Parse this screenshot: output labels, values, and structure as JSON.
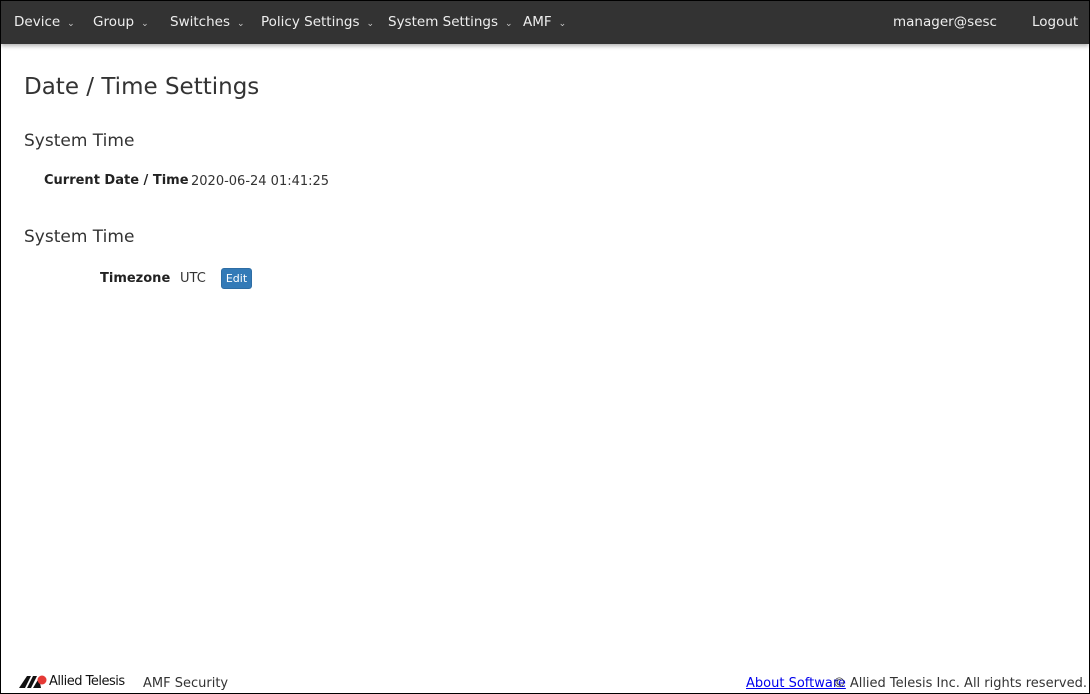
{
  "nav": {
    "items": [
      "Device",
      "Group",
      "Switches",
      "Policy Settings",
      "System Settings",
      "AMF"
    ],
    "user": "manager@sesc",
    "logout": "Logout"
  },
  "page": {
    "title": "Date / Time Settings",
    "section1": "System Time",
    "current_label": "Current Date / Time",
    "current_value": "2020-06-24 01:41:25",
    "section2": "System Time",
    "tz_label": "Timezone",
    "tz_value": "UTC",
    "edit": "Edit"
  },
  "footer": {
    "brand": "Allied Telesis",
    "product": "AMF Security",
    "about": "About Software",
    "copyright": "© Allied Telesis Inc. All rights reserved."
  }
}
